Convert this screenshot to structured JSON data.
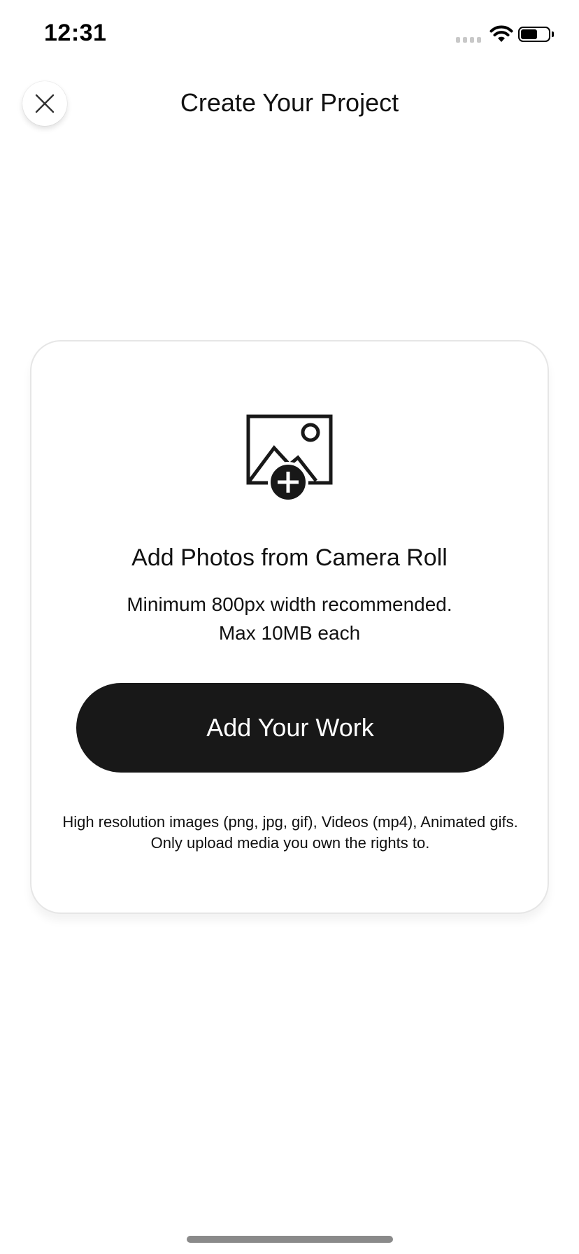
{
  "status_bar": {
    "time": "12:31",
    "icons": [
      "cellular-signal-icon",
      "wifi-icon",
      "battery-icon"
    ],
    "battery_level": 0.6
  },
  "header": {
    "title": "Create Your Project",
    "close_icon": "close-icon"
  },
  "upload_card": {
    "icon": "add-photo-icon",
    "heading": "Add Photos from Camera Roll",
    "requirement_line1": "Minimum 800px width recommended.",
    "requirement_line2": "Max 10MB each",
    "button_label": "Add Your Work",
    "fine_print": "High resolution images (png, jpg, gif), Videos (mp4), Animated gifs. Only upload media you own the rights to."
  },
  "colors": {
    "button_background": "#181818",
    "button_text": "#ffffff",
    "text": "#111111",
    "card_border": "#e6e6e6"
  }
}
